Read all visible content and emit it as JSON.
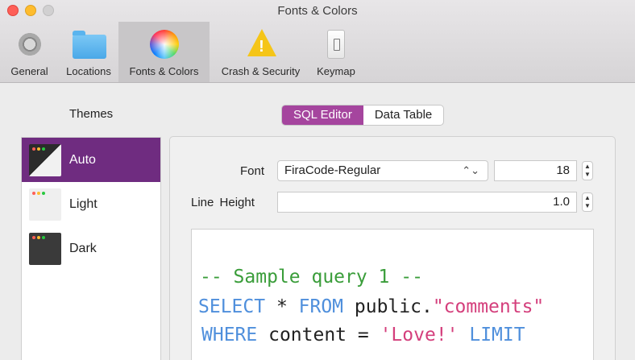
{
  "window": {
    "title": "Fonts & Colors"
  },
  "toolbar": {
    "items": [
      {
        "label": "General",
        "icon": "gear-icon"
      },
      {
        "label": "Locations",
        "icon": "folder-icon"
      },
      {
        "label": "Fonts & Colors",
        "icon": "color-wheel-icon",
        "active": true
      },
      {
        "label": "Crash & Security",
        "icon": "warning-icon"
      },
      {
        "label": "Keymap",
        "icon": "keymap-switch-icon"
      }
    ]
  },
  "themes": {
    "title": "Themes",
    "items": [
      {
        "label": "Auto",
        "selected": true
      },
      {
        "label": "Light"
      },
      {
        "label": "Dark"
      }
    ]
  },
  "segmented": {
    "items": [
      "SQL Editor",
      "Data Table"
    ],
    "active": "SQL Editor"
  },
  "settings": {
    "font_label": "Font",
    "font_value": "FiraCode-Regular",
    "font_size": "18",
    "line_height_label": "Line Height",
    "line_height_value": "1.0"
  },
  "preview": {
    "line1": "-- Sample query 1 --",
    "line2": {
      "kw1": "SELECT",
      "op": " * ",
      "kw2": "FROM",
      "ident": " public.",
      "str": "\"comments\""
    },
    "line3": {
      "kw1": "WHERE",
      "ident": " content = ",
      "str": "'Love!'",
      "kw2": " LIMIT"
    }
  },
  "colors": {
    "accent": "#a5459e",
    "selected_theme": "#6f2c80",
    "comment": "#3a9d3a",
    "keyword": "#4f8fdc",
    "string": "#d43f7c"
  }
}
